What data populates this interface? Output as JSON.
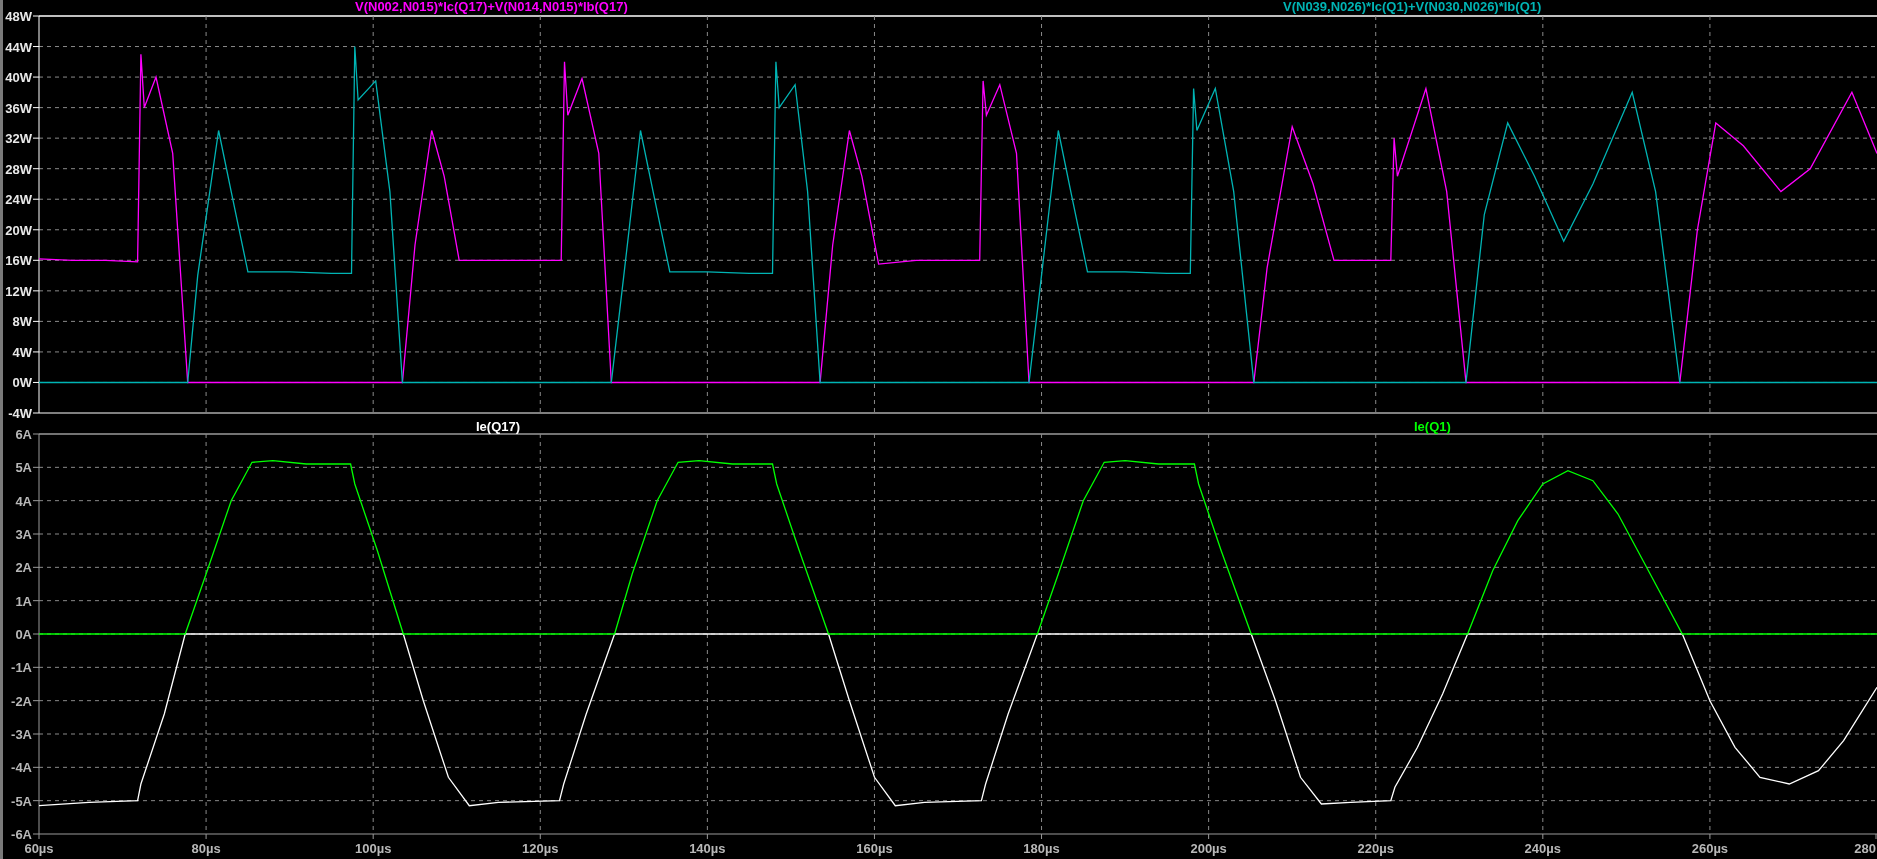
{
  "panes": [
    {
      "chart_data": {
        "type": "line",
        "xlim": [
          60,
          280
        ],
        "ylim": [
          -4,
          48
        ],
        "grid": true,
        "yticks": [
          {
            "value": 48,
            "label": "48W"
          },
          {
            "value": 44,
            "label": "44W"
          },
          {
            "value": 40,
            "label": "40W"
          },
          {
            "value": 36,
            "label": "36W"
          },
          {
            "value": 32,
            "label": "32W"
          },
          {
            "value": 28,
            "label": "28W"
          },
          {
            "value": 24,
            "label": "24W"
          },
          {
            "value": 20,
            "label": "20W"
          },
          {
            "value": 16,
            "label": "16W"
          },
          {
            "value": 12,
            "label": "12W"
          },
          {
            "value": 8,
            "label": "8W"
          },
          {
            "value": 4,
            "label": "4W"
          },
          {
            "value": 0,
            "label": "0W"
          },
          {
            "value": -4,
            "label": "-4W"
          }
        ],
        "x": [
          60,
          64,
          68,
          71.8,
          72.2,
          72.6,
          74,
          76,
          77.8,
          79,
          81.5,
          83,
          85,
          90,
          95,
          97.4,
          97.8,
          98.2,
          100.3,
          102,
          103.5,
          105,
          107,
          108.5,
          110.3,
          115,
          120,
          122.5,
          122.9,
          123.3,
          125,
          127,
          128.5,
          130,
          132,
          133.5,
          135.5,
          140,
          145,
          147.8,
          148.2,
          148.6,
          150.5,
          152,
          153.5,
          155,
          157,
          158.5,
          160.5,
          165,
          170,
          172.6,
          173,
          173.4,
          175,
          177,
          178.5,
          180,
          182,
          183.5,
          185.5,
          190,
          195,
          197.8,
          198.2,
          198.6,
          200.8,
          203,
          205.4,
          207,
          210,
          212.5,
          215,
          220,
          221.8,
          222.2,
          222.6,
          226,
          228.5,
          230.8,
          233,
          235.8,
          239,
          242.5,
          246,
          250.7,
          253.5,
          256.4,
          258.5,
          260.7,
          264,
          268.5,
          272,
          277,
          280
        ],
        "series": [
          {
            "name": "V(N002,N015)*Ic(Q17)+V(N014,N015)*Ib(Q17)",
            "color": "#ff00ff",
            "values": [
              16.2,
              16,
              16,
              15.8,
              43,
              36,
              40,
              30,
              0,
              0,
              0,
              0,
              0,
              0,
              0,
              0,
              0,
              0,
              0,
              0,
              0,
              18,
              33,
              27,
              16,
              16,
              16,
              16,
              42,
              35,
              39.8,
              30,
              0,
              0,
              0,
              0,
              0,
              0,
              0,
              0,
              0,
              0,
              0,
              0,
              0,
              18,
              33,
              27,
              15.5,
              16,
              16,
              16,
              39.5,
              35,
              39,
              30,
              0,
              0,
              0,
              0,
              0,
              0,
              0,
              0,
              0,
              0,
              0,
              0,
              0,
              15,
              33.5,
              26,
              16,
              16,
              16,
              32,
              27,
              38.5,
              25,
              0,
              0,
              0,
              0,
              0,
              0,
              0,
              0,
              0,
              20,
              34,
              31,
              25,
              28,
              38,
              30
            ]
          },
          {
            "name": "V(N039,N026)*Ic(Q1)+V(N030,N026)*Ib(Q1)",
            "color": "#00b4b4",
            "values": [
              0,
              0,
              0,
              0,
              0,
              0,
              0,
              0,
              0,
              14,
              33,
              25,
              14.5,
              14.5,
              14.3,
              14.3,
              44,
              37,
              39.5,
              25,
              0,
              0,
              0,
              0,
              0,
              0,
              0,
              0,
              0,
              0,
              0,
              0,
              0,
              14,
              33,
              25,
              14.5,
              14.5,
              14.3,
              14.3,
              42,
              36,
              39,
              25,
              0,
              0,
              0,
              0,
              0,
              0,
              0,
              0,
              0,
              0,
              0,
              0,
              0,
              14,
              33,
              25,
              14.5,
              14.5,
              14.3,
              14.3,
              38.5,
              33,
              38.5,
              25,
              0,
              0,
              0,
              0,
              0,
              0,
              0,
              0,
              0,
              0,
              0,
              0,
              22,
              34,
              27,
              18.5,
              26,
              38,
              25,
              0,
              0,
              0,
              0,
              0,
              0,
              0,
              0
            ]
          }
        ]
      }
    },
    {
      "chart_data": {
        "type": "line",
        "xlim": [
          60,
          280
        ],
        "ylim": [
          -6,
          6
        ],
        "grid": true,
        "xticks": [
          {
            "value": 60,
            "label": "60µs"
          },
          {
            "value": 80,
            "label": "80µs"
          },
          {
            "value": 100,
            "label": "100µs"
          },
          {
            "value": 120,
            "label": "120µs"
          },
          {
            "value": 140,
            "label": "140µs"
          },
          {
            "value": 160,
            "label": "160µs"
          },
          {
            "value": 180,
            "label": "180µs"
          },
          {
            "value": 200,
            "label": "200µs"
          },
          {
            "value": 220,
            "label": "220µs"
          },
          {
            "value": 240,
            "label": "240µs"
          },
          {
            "value": 260,
            "label": "260µs"
          },
          {
            "value": 280,
            "label": "280"
          }
        ],
        "yticks": [
          {
            "value": 6,
            "label": "6A"
          },
          {
            "value": 5,
            "label": "5A"
          },
          {
            "value": 4,
            "label": "4A"
          },
          {
            "value": 3,
            "label": "3A"
          },
          {
            "value": 2,
            "label": "2A"
          },
          {
            "value": 1,
            "label": "1A"
          },
          {
            "value": 0,
            "label": "0A"
          },
          {
            "value": -1,
            "label": "-1A"
          },
          {
            "value": -2,
            "label": "-2A"
          },
          {
            "value": -3,
            "label": "-3A"
          },
          {
            "value": -4,
            "label": "-4A"
          },
          {
            "value": -5,
            "label": "-5A"
          },
          {
            "value": -6,
            "label": "-6A"
          }
        ],
        "x": [
          60,
          66,
          71.8,
          72.2,
          75,
          77.5,
          80,
          83,
          85.5,
          88,
          92,
          97.3,
          97.8,
          100.5,
          103.6,
          106,
          109,
          111.5,
          115,
          122.3,
          122.8,
          125.5,
          128.9,
          131,
          134,
          136.5,
          139,
          143,
          147.8,
          148.3,
          151,
          154.5,
          157,
          160,
          162.5,
          166,
          172.8,
          173.3,
          176,
          179.5,
          182,
          185,
          187.5,
          190,
          194,
          198.3,
          198.8,
          201.5,
          205.1,
          208,
          211,
          213.5,
          217,
          221.8,
          222.3,
          225,
          228,
          231,
          234,
          237,
          240,
          243,
          246,
          249,
          252,
          256.7,
          260,
          263,
          266,
          269.5,
          273,
          276,
          280
        ],
        "series": [
          {
            "name": "Ie(Q17)",
            "color": "#ffffff",
            "values": [
              -5.15,
              -5.05,
              -5,
              -4.5,
              -2.4,
              0,
              0,
              0,
              0,
              0,
              0,
              0,
              0,
              0,
              0,
              -2,
              -4.3,
              -5.15,
              -5.05,
              -5,
              -4.5,
              -2.4,
              0,
              0,
              0,
              0,
              0,
              0,
              0,
              0,
              0,
              0,
              -2,
              -4.3,
              -5.15,
              -5.05,
              -5,
              -4.5,
              -2.4,
              0,
              0,
              0,
              0,
              0,
              0,
              0,
              0,
              0,
              0,
              -2,
              -4.3,
              -5.1,
              -5.05,
              -5,
              -4.6,
              -3.4,
              -1.8,
              0,
              0,
              0,
              0,
              0,
              0,
              0,
              0,
              0,
              -2,
              -3.4,
              -4.3,
              -4.5,
              -4.1,
              -3.2,
              -1.6
            ]
          },
          {
            "name": "Ie(Q1)",
            "color": "#00ff00",
            "values": [
              0,
              0,
              0,
              0,
              0,
              0,
              1.8,
              4,
              5.15,
              5.2,
              5.1,
              5.1,
              4.5,
              2.5,
              0,
              0,
              0,
              0,
              0,
              0,
              0,
              0,
              0,
              1.8,
              4,
              5.15,
              5.2,
              5.1,
              5.1,
              4.5,
              2.5,
              0,
              0,
              0,
              0,
              0,
              0,
              0,
              0,
              0,
              1.8,
              4,
              5.15,
              5.2,
              5.1,
              5.1,
              4.5,
              2.5,
              0,
              0,
              0,
              0,
              0,
              0,
              0,
              0,
              0,
              0,
              1.9,
              3.4,
              4.5,
              4.9,
              4.6,
              3.6,
              2.2,
              0,
              0,
              0,
              0,
              0,
              0,
              0,
              0
            ]
          }
        ]
      }
    }
  ]
}
